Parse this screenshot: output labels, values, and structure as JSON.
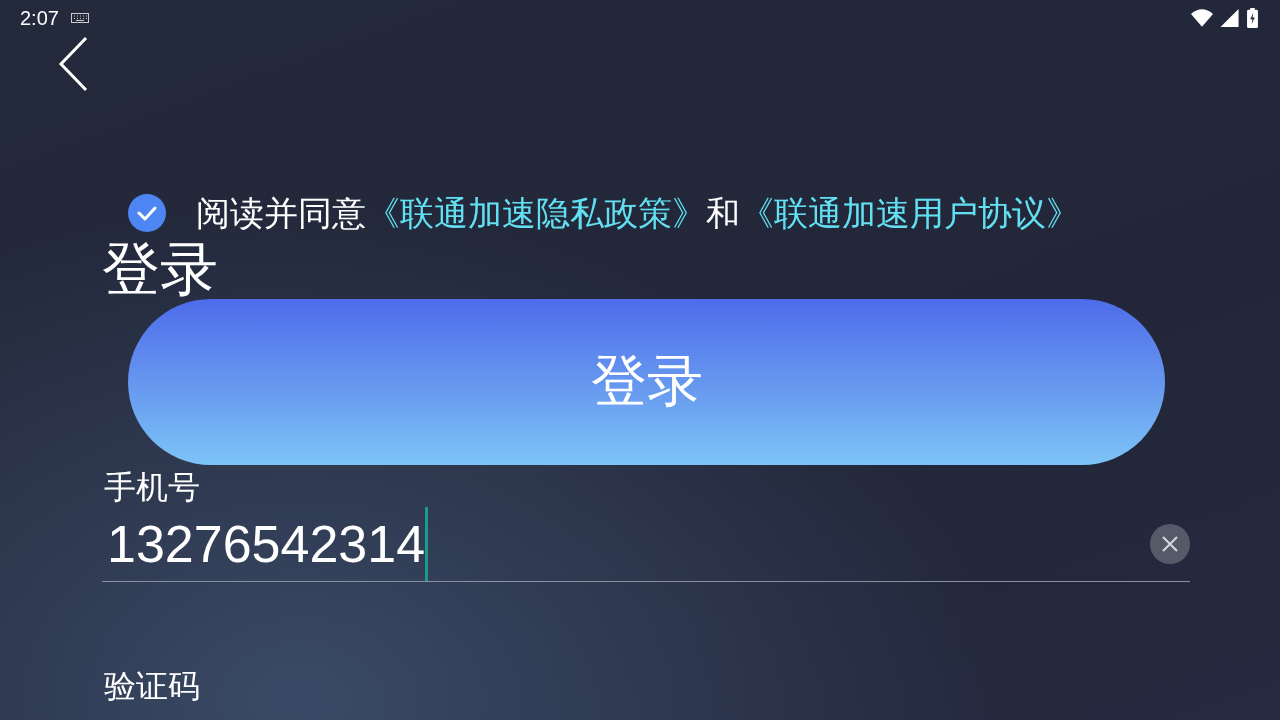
{
  "status_bar": {
    "time": "2:07"
  },
  "agreement": {
    "checked": true,
    "parts": [
      {
        "text": "阅读并同意",
        "kind": "plain"
      },
      {
        "text": "《联通加速隐私政策》",
        "kind": "link"
      },
      {
        "text": "和",
        "kind": "plain"
      },
      {
        "text": "《联通加速用户协议》",
        "kind": "link"
      }
    ]
  },
  "title": "登录",
  "login_button": {
    "label": "登录"
  },
  "phone": {
    "label": "手机号",
    "value": "13276542314",
    "focused": true
  },
  "code": {
    "label": "验证码"
  }
}
